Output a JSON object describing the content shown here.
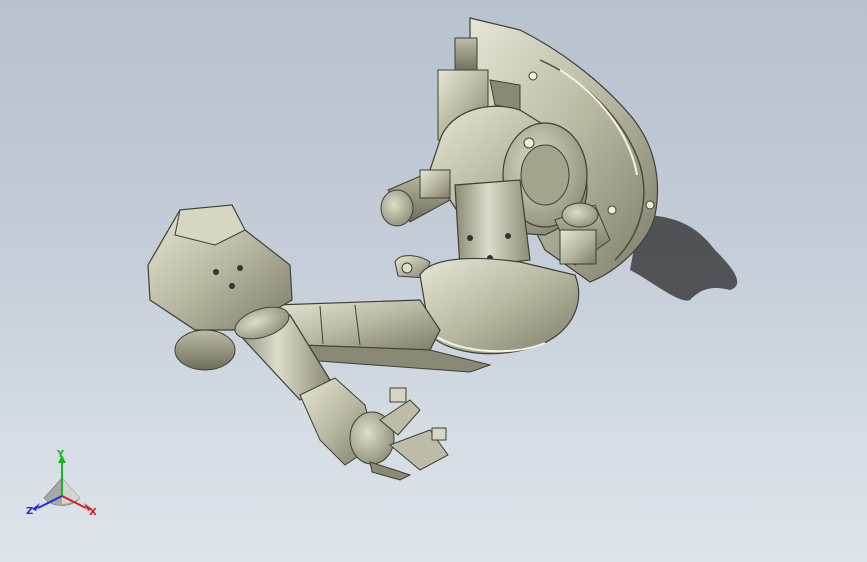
{
  "viewport": {
    "background_top": "#b7c2cf",
    "background_bottom": "#dee4ea"
  },
  "model": {
    "description_icon": "robot-arm-model",
    "body_color": "#a9a893",
    "shadow_color": "#3c3d3f"
  },
  "triad": {
    "x_label": "X",
    "y_label": "Y",
    "z_label": "Z",
    "x_color": "#d81e1e",
    "y_color": "#1fb21f",
    "z_color": "#1e2fd8"
  }
}
